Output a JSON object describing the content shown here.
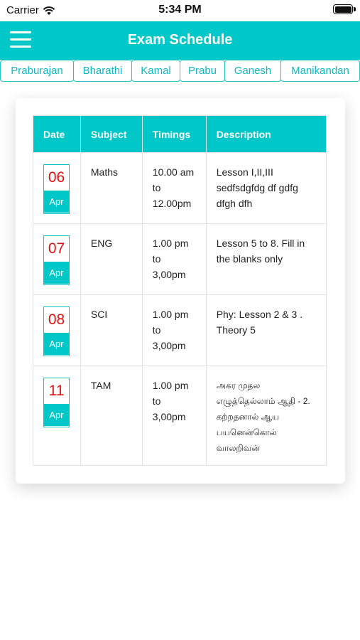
{
  "status_bar": {
    "carrier": "Carrier",
    "time": "5:34 PM"
  },
  "nav": {
    "title": "Exam Schedule"
  },
  "tabs": [
    "Praburajan",
    "Bharathi",
    "Kamal",
    "Prabu",
    "Ganesh",
    "Manikandan"
  ],
  "table": {
    "headers": {
      "date": "Date",
      "subject": "Subject",
      "timings": "Timings",
      "description": "Description"
    },
    "rows": [
      {
        "day": "06",
        "month": "Apr",
        "subject": "Maths",
        "timings": "10.00 am to 12.00pm",
        "description": "Lesson I,II,III sedfsdgfdg df gdfg dfgh dfh"
      },
      {
        "day": "07",
        "month": "Apr",
        "subject": "ENG",
        "timings": "1.00 pm to 3,00pm",
        "description": "Lesson 5 to 8. Fill in the blanks only"
      },
      {
        "day": "08",
        "month": "Apr",
        "subject": "SCI",
        "timings": "1.00 pm to 3,00pm",
        "description": "Phy: Lesson 2 & 3 . Theory 5"
      },
      {
        "day": "11",
        "month": "Apr",
        "subject": "TAM",
        "timings": "1.00 pm to 3,00pm",
        "description": "அகர முதல எழுத்தெல்லாம் ஆதி - 2. கற்றதனால் ஆய பயனென்கொல் வாலறிவன்"
      }
    ]
  },
  "colors": {
    "accent": "#00c8c8",
    "date_text": "#e01010",
    "tab_text": "#10b8c0"
  }
}
